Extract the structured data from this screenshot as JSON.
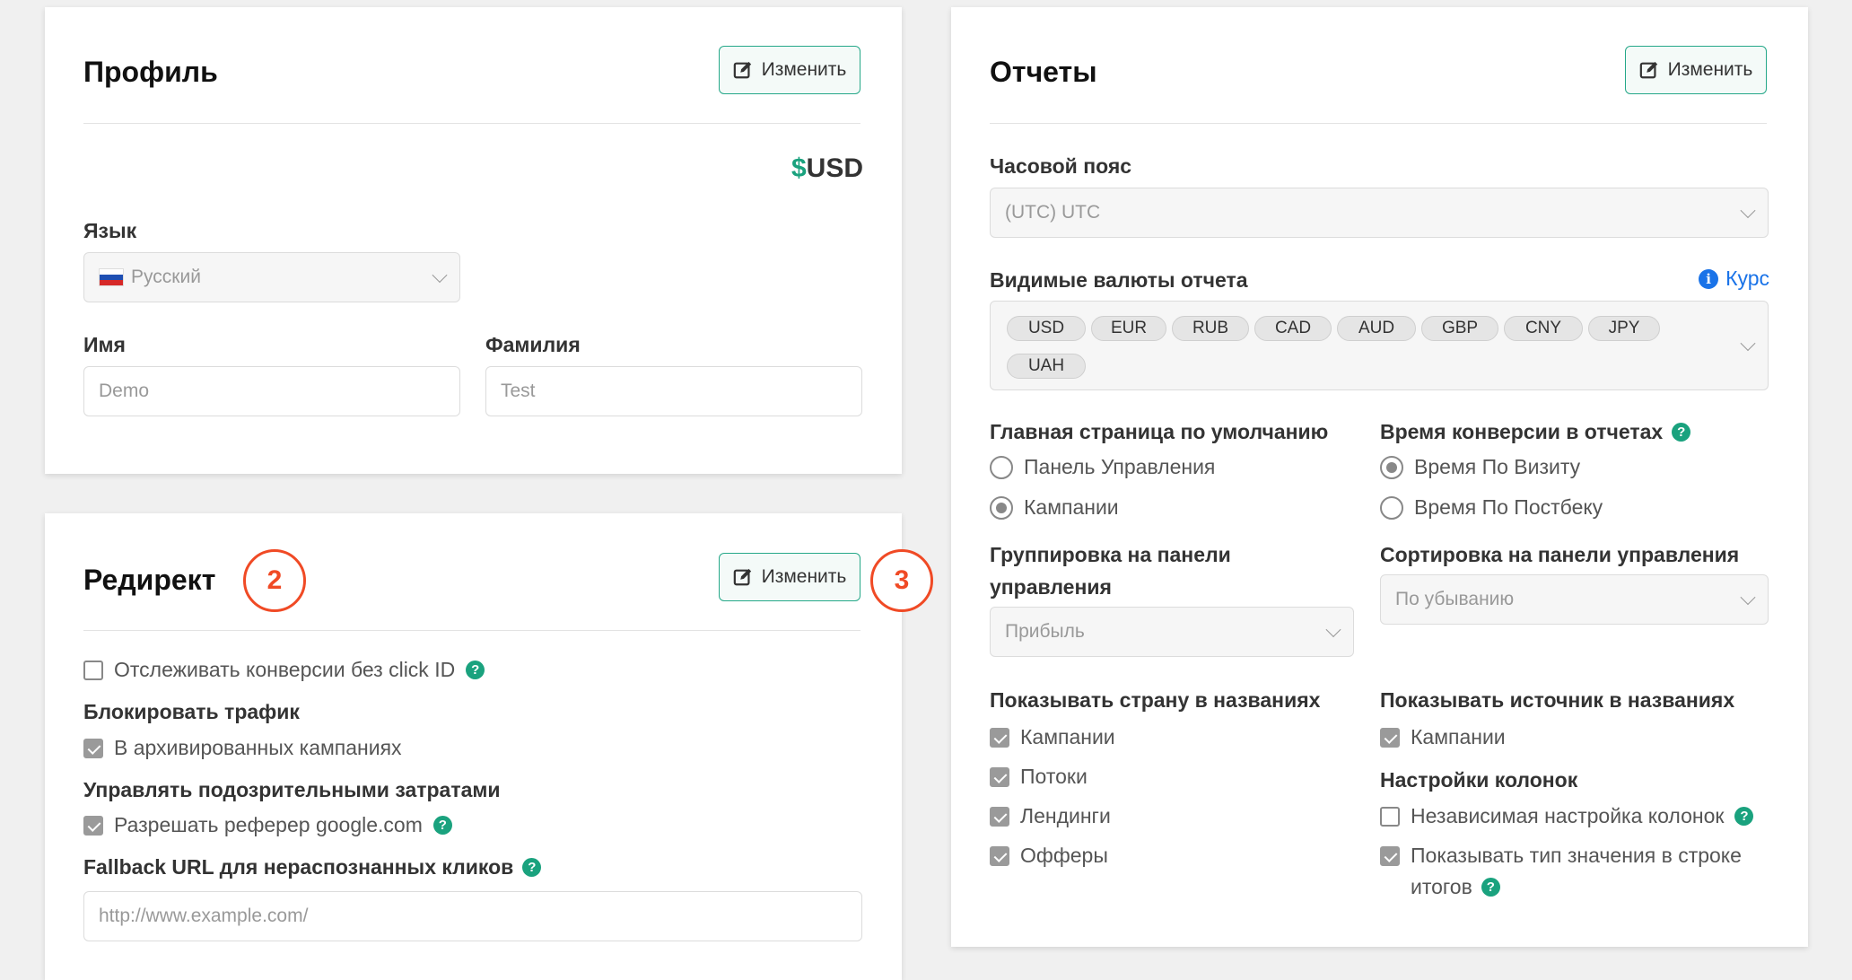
{
  "profile": {
    "title": "Профиль",
    "edit_label": "Изменить",
    "currency_symbol": "$",
    "currency_code": "USD",
    "language_label": "Язык",
    "language_value": "Русский",
    "first_name_label": "Имя",
    "first_name_placeholder": "Demo",
    "last_name_label": "Фамилия",
    "last_name_placeholder": "Test"
  },
  "redirect": {
    "title": "Редирект",
    "edit_label": "Изменить",
    "track_conversions_label": "Отслеживать конверсии без click ID",
    "block_traffic_label": "Блокировать трафик",
    "archived_campaigns_label": "В архивированных кампаниях",
    "suspicious_costs_label": "Управлять подозрительными затратами",
    "allow_referrer_label": "Разрешать реферер google.com",
    "fallback_url_label": "Fallback URL для нераспознанных кликов",
    "fallback_url_placeholder": "http://www.example.com/"
  },
  "reports": {
    "title": "Отчеты",
    "edit_label": "Изменить",
    "timezone_label": "Часовой пояс",
    "timezone_value": "(UTC) UTC",
    "currencies_label": "Видимые валюты отчета",
    "rate_link": "Курс",
    "currencies": [
      "USD",
      "EUR",
      "RUB",
      "CAD",
      "AUD",
      "GBP",
      "CNY",
      "JPY",
      "UAH"
    ],
    "home_page_label": "Главная страница по умолчанию",
    "home_options": [
      "Панель Управления",
      "Кампании"
    ],
    "home_selected": 1,
    "conversion_time_label": "Время конверсии в отчетах",
    "conversion_options": [
      "Время По Визиту",
      "Время По Постбеку"
    ],
    "conversion_selected": 0,
    "grouping_label_line1": "Группировка на панели",
    "grouping_label_line2": "управления",
    "grouping_value": "Прибыль",
    "sorting_label": "Сортировка на панели управления",
    "sorting_value": "По убыванию",
    "show_country_label": "Показывать страну в названиях",
    "country_options": [
      "Кампании",
      "Потоки",
      "Лендинги",
      "Офферы"
    ],
    "show_source_label": "Показывать источник в названиях",
    "source_options": [
      "Кампании"
    ],
    "column_settings_label": "Настройки колонок",
    "independent_columns_label": "Независимая настройка колонок",
    "value_type_line1": "Показывать тип значения в строке",
    "value_type_line2": "итогов"
  },
  "markers": [
    "2",
    "3"
  ],
  "icons": {
    "edit": "edit-icon",
    "help": "help-icon",
    "info": "info-icon",
    "flag": "russia-flag-icon",
    "chevron": "chevron-down-icon"
  },
  "colors": {
    "accent": "#26a889",
    "help": "#1aa27e",
    "link": "#1a73e8",
    "marker": "#f04a25"
  }
}
